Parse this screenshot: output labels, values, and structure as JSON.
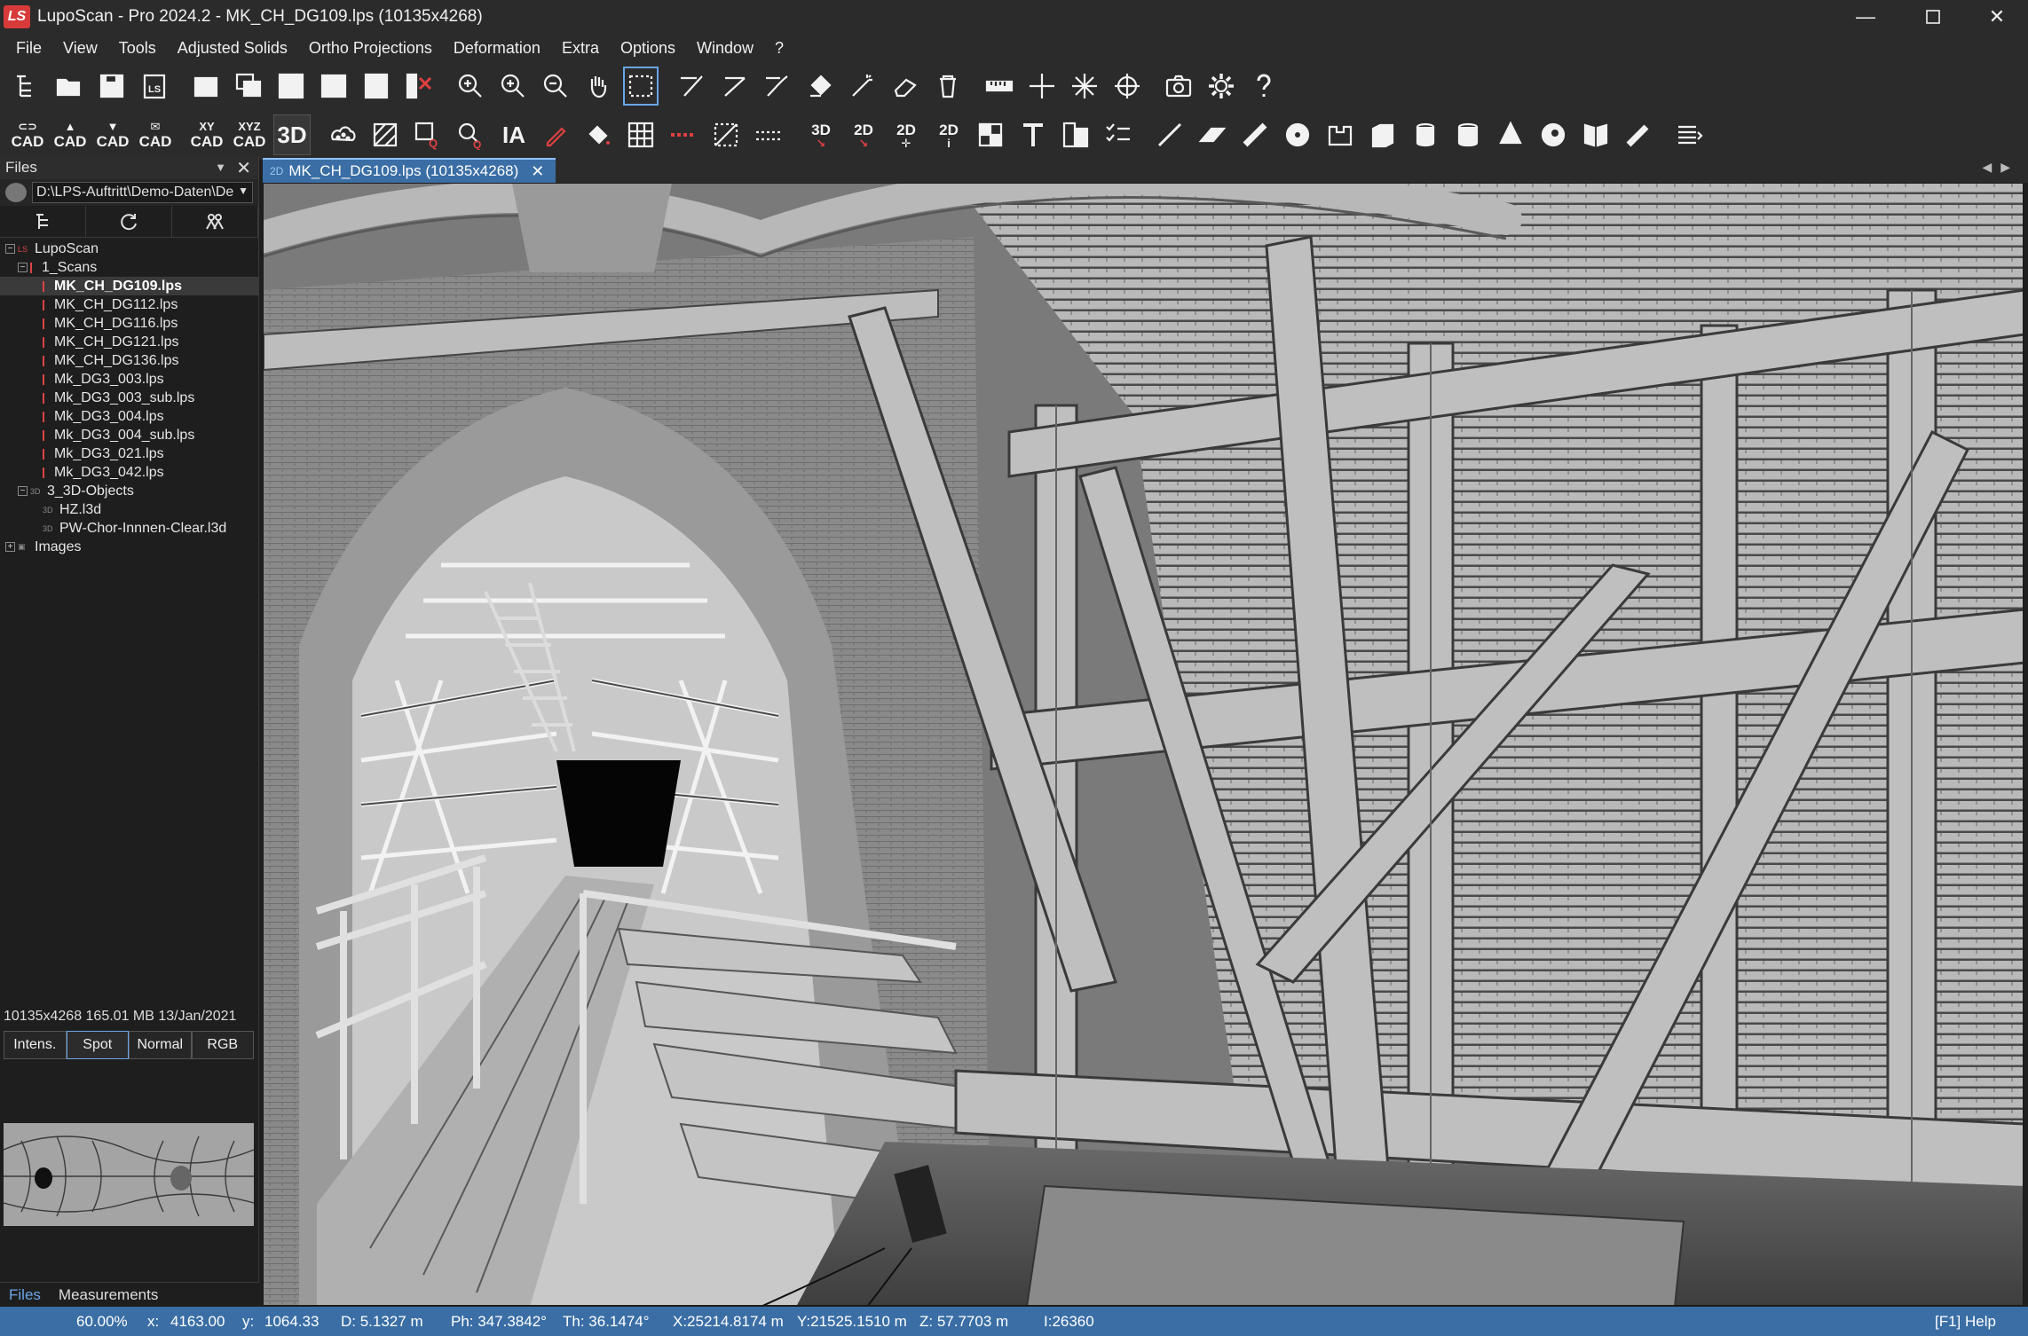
{
  "window": {
    "title": "LupoScan - Pro 2024.2 - MK_CH_DG109.lps (10135x4268)",
    "logo_text": "LS",
    "minimize": "—",
    "close": "✕"
  },
  "menu": [
    "File",
    "View",
    "Tools",
    "Adjusted Solids",
    "Ortho Projections",
    "Deformation",
    "Extra",
    "Options",
    "Window",
    "?"
  ],
  "toolbar2_labels": {
    "cad1_top": "CAD",
    "cad2_top": "CAD",
    "cad3_top": "CAD",
    "cad4_top": "CAD",
    "xy": "XY",
    "xy_cad": "CAD",
    "xyz": "XYZ",
    "xyz_cad": "CAD",
    "three_d": "3D",
    "ia": "IA",
    "to3d": "3D",
    "to2d": "2D",
    "twod_a": "2D",
    "twod_i": "2D"
  },
  "left_panel": {
    "title": "Files",
    "path": "D:\\LPS-Auftritt\\Demo-Daten\\De",
    "tree": [
      {
        "label": "LupoScan",
        "level": 0,
        "toggle": "−",
        "icon": "ls"
      },
      {
        "label": "1_Scans",
        "level": 1,
        "toggle": "−",
        "icon": "folder"
      },
      {
        "label": "MK_CH_DG109.lps",
        "level": 2,
        "icon": "scan",
        "selected": true
      },
      {
        "label": "MK_CH_DG112.lps",
        "level": 2,
        "icon": "scan"
      },
      {
        "label": "MK_CH_DG116.lps",
        "level": 2,
        "icon": "scan"
      },
      {
        "label": "MK_CH_DG121.lps",
        "level": 2,
        "icon": "scan"
      },
      {
        "label": "MK_CH_DG136.lps",
        "level": 2,
        "icon": "scan"
      },
      {
        "label": "Mk_DG3_003.lps",
        "level": 2,
        "icon": "scan"
      },
      {
        "label": "Mk_DG3_003_sub.lps",
        "level": 2,
        "icon": "scan"
      },
      {
        "label": "Mk_DG3_004.lps",
        "level": 2,
        "icon": "scan"
      },
      {
        "label": "Mk_DG3_004_sub.lps",
        "level": 2,
        "icon": "scan"
      },
      {
        "label": "Mk_DG3_021.lps",
        "level": 2,
        "icon": "scan"
      },
      {
        "label": "Mk_DG3_042.lps",
        "level": 2,
        "icon": "scan"
      },
      {
        "label": "3_3D-Objects",
        "level": 1,
        "toggle": "−",
        "icon": "3d"
      },
      {
        "label": "HZ.l3d",
        "level": 2,
        "icon": "3d"
      },
      {
        "label": "PW-Chor-Innnen-Clear.l3d",
        "level": 2,
        "icon": "3d"
      },
      {
        "label": "Images",
        "level": 0,
        "toggle": "+",
        "icon": "img"
      }
    ],
    "file_info": "10135x4268   165.01 MB   13/Jan/2021",
    "view_tabs": [
      "Intens.",
      "Spot",
      "Normal",
      "RGB"
    ],
    "active_view_tab": "Spot",
    "bottom_tabs": [
      "Files",
      "Measurements"
    ],
    "active_bottom_tab": "Files"
  },
  "document_tab": {
    "badge": "2D",
    "label": "MK_CH_DG109.lps (10135x4268)",
    "close": "✕"
  },
  "status": {
    "zoom": "60.00%",
    "x_label": "x:",
    "x_val": "4163.00",
    "y_label": "y:",
    "y_val": "1064.33",
    "d": "D: 5.1327 m",
    "ph": "Ph: 347.3842°",
    "th": "Th:  36.1474°",
    "X": "X:25214.8174 m",
    "Y": "Y:21525.1510 m",
    "Z": "Z:  57.7703 m",
    "i": "I:26360",
    "help": "[F1] Help"
  }
}
